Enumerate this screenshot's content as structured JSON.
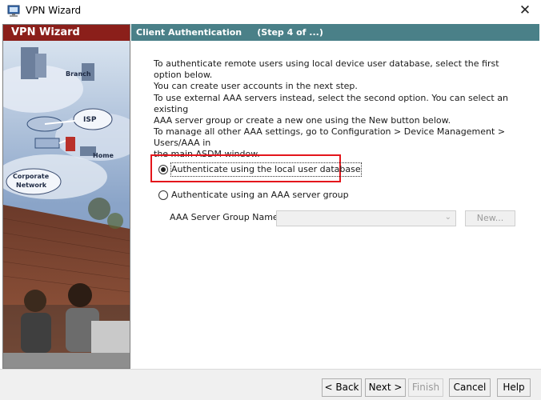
{
  "window": {
    "title": "VPN Wizard",
    "close_symbol": "✕"
  },
  "left": {
    "title": "VPN Wizard",
    "art_labels": [
      "Branch",
      "ISP",
      "Home",
      "Corporate",
      "Network"
    ]
  },
  "header": {
    "step_title": "Client Authentication     (Step 4 of ...)"
  },
  "content": {
    "para1": [
      "To authenticate remote users using local device user database, select the first option below.",
      "You can create user accounts in the next step."
    ],
    "para2": [
      "To use external AAA servers instead, select the second option. You can select an existing",
      "AAA server group or create a new one using the New button below.",
      "To manage all other AAA settings, go to Configuration > Device Management > Users/AAA in",
      "the main ASDM window."
    ],
    "option_local": "Authenticate using the local user database",
    "option_aaa": "Authenticate using an AAA server group",
    "selected_option": "local",
    "group_label": "AAA Server Group Name:",
    "group_value": "",
    "new_button": "New..."
  },
  "footer": {
    "back": "< Back",
    "next": "Next >",
    "finish": "Finish",
    "cancel": "Cancel",
    "help": "Help"
  },
  "colors": {
    "left_header": "#8b1f1a",
    "step_header": "#4a8088",
    "highlight": "#e4151b"
  }
}
